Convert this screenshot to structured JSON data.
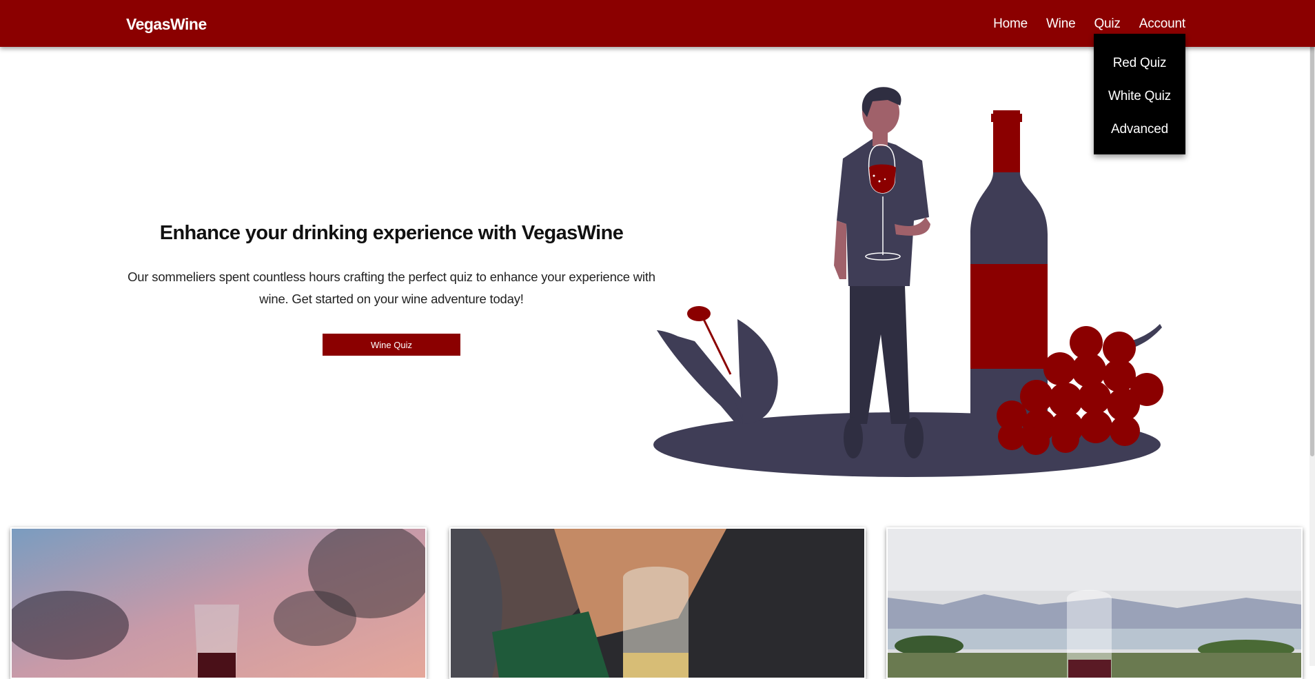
{
  "nav": {
    "brand": "VegasWine",
    "links": [
      "Home",
      "Wine",
      "Quiz",
      "Account"
    ]
  },
  "quiz_dropdown": {
    "items": [
      "Red Quiz",
      "White Quiz",
      "Advanced"
    ]
  },
  "hero": {
    "title": "Enhance your drinking experience with VegasWine",
    "text_line1": "Our sommeliers spent countless hours crafting the perfect quiz to enhance your experience with",
    "text_line2": "wine. Get started on your wine adventure today!",
    "button": "Wine Quiz"
  },
  "colors": {
    "brand": "#8b0000",
    "dropdown_bg": "#000000",
    "illustration_dark": "#3f3d56"
  },
  "cards": [
    {
      "image": "red-wine-glass-sunset-photo"
    },
    {
      "image": "white-wine-glass-person-photo"
    },
    {
      "image": "wine-glass-lake-view-photo"
    }
  ]
}
